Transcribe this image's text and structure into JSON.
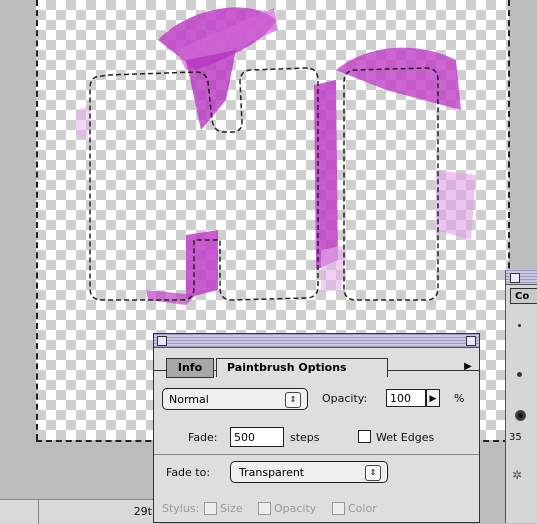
{
  "status": {
    "zoom_label": "29t"
  },
  "side_panel": {
    "tab_label": "Co",
    "brush_size": "35"
  },
  "palette": {
    "tabs": {
      "info": "Info",
      "paintbrush": "Paintbrush Options"
    },
    "menu_arrow": "▶",
    "mode": {
      "value": "Normal",
      "arrow": "⇕"
    },
    "opacity": {
      "label": "Opacity:",
      "value": "100",
      "arrow": "▶",
      "unit": "%"
    },
    "fade": {
      "label": "Fade:",
      "value": "500",
      "unit": "steps"
    },
    "wet_edges": {
      "label": "Wet Edges",
      "checked": false
    },
    "fade_to": {
      "label": "Fade to:",
      "value": "Transparent",
      "arrow": "⇕"
    },
    "stylus": {
      "label": "Stylus:",
      "size": "Size",
      "opacity": "Opacity",
      "color": "Color"
    }
  },
  "colors": {
    "paint": "#c040c8",
    "selection": "#222222"
  },
  "icons": [
    "palette-close-icon",
    "palette-zoom-icon",
    "menu-arrow-icon",
    "brush-preset-icon"
  ]
}
